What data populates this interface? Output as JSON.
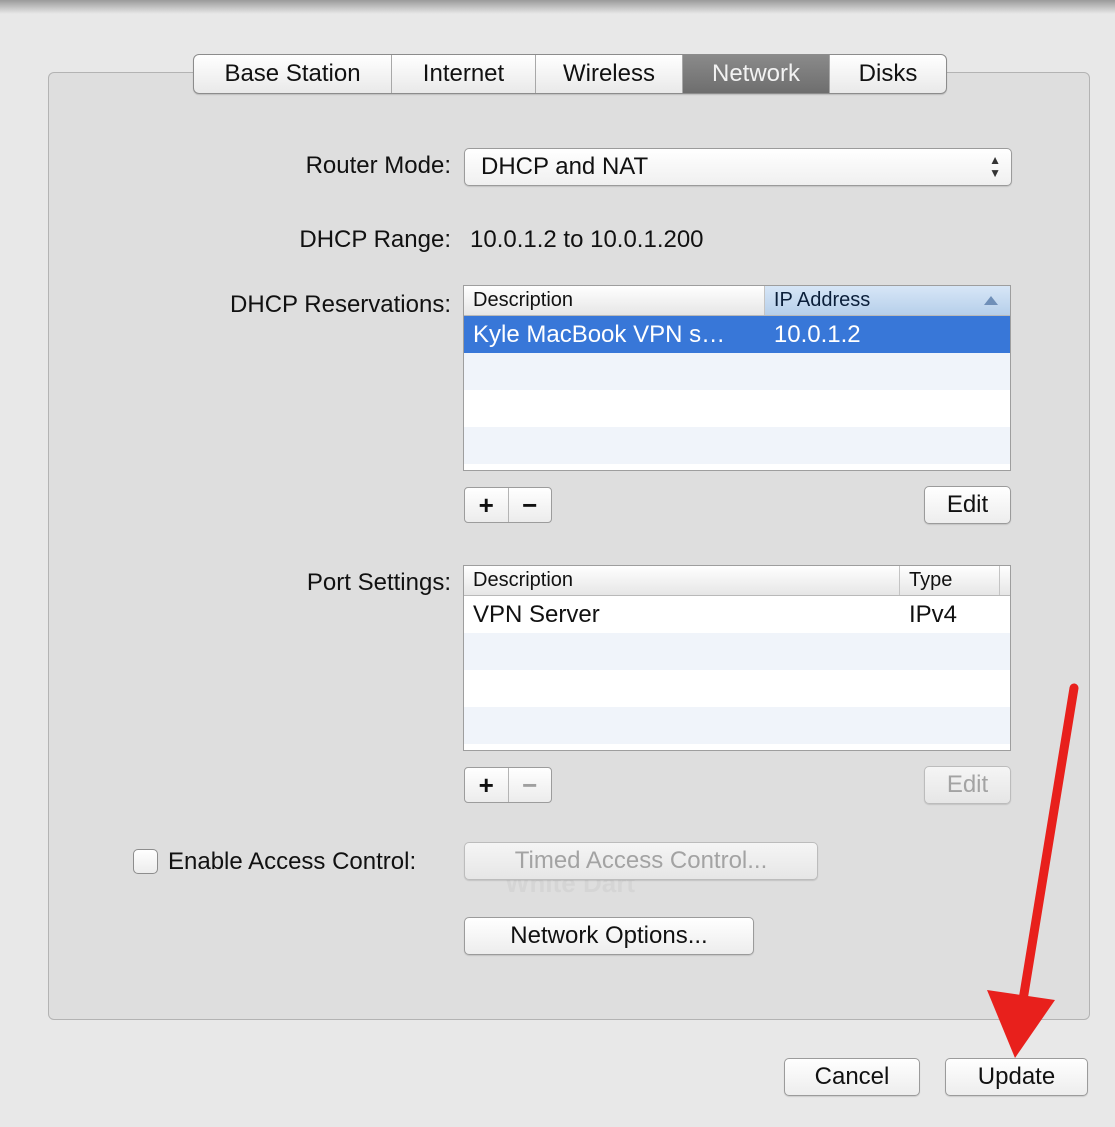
{
  "tabs": [
    {
      "label": "Base Station",
      "selected": false
    },
    {
      "label": "Internet",
      "selected": false
    },
    {
      "label": "Wireless",
      "selected": false
    },
    {
      "label": "Network",
      "selected": true
    },
    {
      "label": "Disks",
      "selected": false
    }
  ],
  "router_mode": {
    "label": "Router Mode:",
    "value": "DHCP and NAT"
  },
  "dhcp_range": {
    "label": "DHCP Range:",
    "value": "10.0.1.2 to 10.0.1.200"
  },
  "dhcp_reservations": {
    "label": "DHCP Reservations:",
    "columns": [
      "Description",
      "IP Address"
    ],
    "rows": [
      {
        "description": "Kyle MacBook VPN s…",
        "ip": "10.0.1.2",
        "selected": true
      }
    ],
    "add_label": "+",
    "remove_label": "−",
    "edit_label": "Edit"
  },
  "port_settings": {
    "label": "Port Settings:",
    "columns": [
      "Description",
      "Type"
    ],
    "rows": [
      {
        "description": "VPN Server",
        "type": "IPv4"
      }
    ],
    "add_label": "+",
    "remove_label": "−",
    "edit_label": "Edit"
  },
  "access_control": {
    "label": "Enable Access Control:",
    "checked": false,
    "timed_button": "Timed Access Control..."
  },
  "network_options_button": "Network Options...",
  "footer": {
    "cancel": "Cancel",
    "update": "Update"
  },
  "colors": {
    "selection": "#3877d8",
    "annotation_arrow": "#e8201c"
  }
}
